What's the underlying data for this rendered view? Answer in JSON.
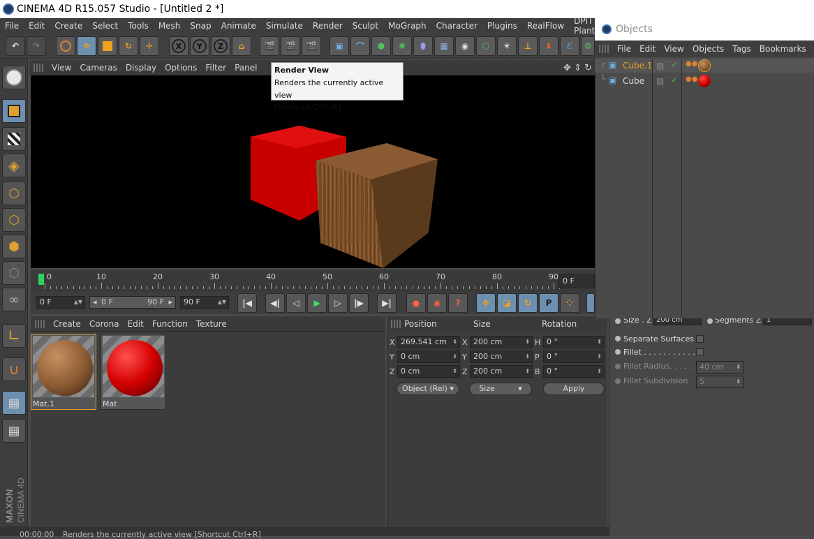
{
  "window": {
    "title": "CINEMA 4D R15.057 Studio - [Untitled 2 *]"
  },
  "menubar": {
    "items": [
      "File",
      "Edit",
      "Create",
      "Select",
      "Tools",
      "Mesh",
      "Snap",
      "Animate",
      "Simulate",
      "Render",
      "Sculpt",
      "MoGraph",
      "Character",
      "Plugins",
      "RealFlow",
      "DPIT Plants"
    ]
  },
  "toolbar": {
    "undo": "undo-icon",
    "redo": "redo-icon",
    "axis_x": "X",
    "axis_y": "Y",
    "axis_z": "Z"
  },
  "viewport_menu": {
    "items": [
      "View",
      "Cameras",
      "Display",
      "Options",
      "Filter",
      "Panel"
    ]
  },
  "tooltip": {
    "title": "Render View",
    "desc": "Renders the currently active view",
    "shortcut": "[Shortcut Ctrl+R]"
  },
  "timeline": {
    "labels": [
      "0",
      "10",
      "20",
      "30",
      "40",
      "50",
      "60",
      "70",
      "80",
      "90"
    ],
    "current_frame": "0 F"
  },
  "playback": {
    "start": "0 F",
    "range_start": "0 F",
    "range_end": "90 F",
    "end": "90 F"
  },
  "material_menu": {
    "items": [
      "Create",
      "Corona",
      "Edit",
      "Function",
      "Texture"
    ]
  },
  "materials": [
    {
      "name": "Mat.1",
      "color": "#8a5a32",
      "selected": true
    },
    {
      "name": "Mat",
      "color": "#d40000",
      "selected": false
    }
  ],
  "coordinates": {
    "headers": {
      "position": "Position",
      "size": "Size",
      "rotation": "Rotation"
    },
    "position": {
      "x": "269.541 cm",
      "y": "0 cm",
      "z": "0 cm"
    },
    "size": {
      "x": "200 cm",
      "y": "200 cm",
      "z": "200 cm"
    },
    "rotation": {
      "h": "0 °",
      "p": "0 °",
      "b": "0 °"
    },
    "mode": "Object (Rel)",
    "size_mode": "Size",
    "apply": "Apply"
  },
  "attributes": {
    "size_z_label": "Size . Z",
    "size_z_value": "200 cm",
    "segments_z_label": "Segments Z",
    "segments_z_value": "1",
    "separate_surfaces": "Separate Surfaces",
    "fillet": "Fillet . . . . . . . . . . .",
    "fillet_radius": "Fillet Radius. . . . .",
    "fillet_radius_value": "40 cm",
    "fillet_subdivision": "Fillet Subdivision",
    "fillet_subdivision_value": "5"
  },
  "objects_window": {
    "title": "Objects",
    "menu": [
      "File",
      "Edit",
      "View",
      "Objects",
      "Tags",
      "Bookmarks"
    ],
    "rows": [
      {
        "name": "Cube.1",
        "selected": true,
        "material_color": "#8a5a32"
      },
      {
        "name": "Cube",
        "selected": false,
        "material_color": "#d40000"
      }
    ]
  },
  "statusbar": {
    "time": "00:00:00",
    "text": "Renders the currently active view [Shortcut Ctrl+R]"
  },
  "branding": {
    "maxon": "MAXON",
    "product": "CINEMA 4D"
  },
  "colors": {
    "accent_orange": "#e0a030",
    "selection_blue": "#6d8fb0",
    "cube_red": "#d40000",
    "wood": "#8a5a32"
  }
}
